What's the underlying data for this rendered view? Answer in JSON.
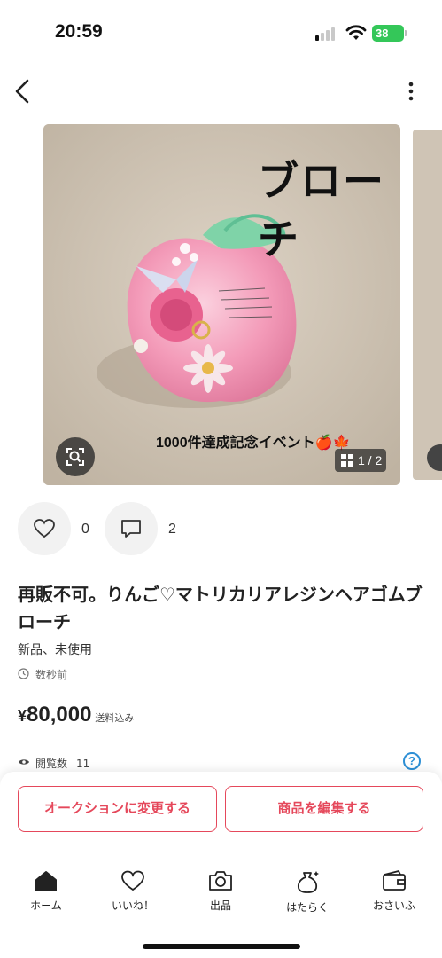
{
  "status_bar": {
    "time": "20:59",
    "battery": "38"
  },
  "photo": {
    "overlay_title": "ブローチ",
    "caption": "1000件達成記念イベント🍎🍁",
    "counter": "1 / 2"
  },
  "actions": {
    "likes": "0",
    "comments": "2"
  },
  "item": {
    "title": "再販不可。りんご♡マトリカリアレジンヘアゴムブローチ",
    "condition": "新品、未使用",
    "posted": "数秒前",
    "price_symbol": "¥",
    "price": "80,000",
    "shipping": "送料込み",
    "views_label": "閲覧数",
    "views": "11",
    "help": "?"
  },
  "buttons": {
    "auction": "オークションに変更する",
    "edit": "商品を編集する"
  },
  "tabs": [
    {
      "label": "ホーム",
      "icon": "home-icon"
    },
    {
      "label": "いいね！",
      "icon": "heart-icon"
    },
    {
      "label": "出品",
      "icon": "camera-icon"
    },
    {
      "label": "はたらく",
      "icon": "money-bag-icon"
    },
    {
      "label": "おさいふ",
      "icon": "wallet-icon"
    }
  ],
  "colors": {
    "accent": "#e5485b",
    "battery": "#34c759",
    "help": "#2d8fd5"
  }
}
